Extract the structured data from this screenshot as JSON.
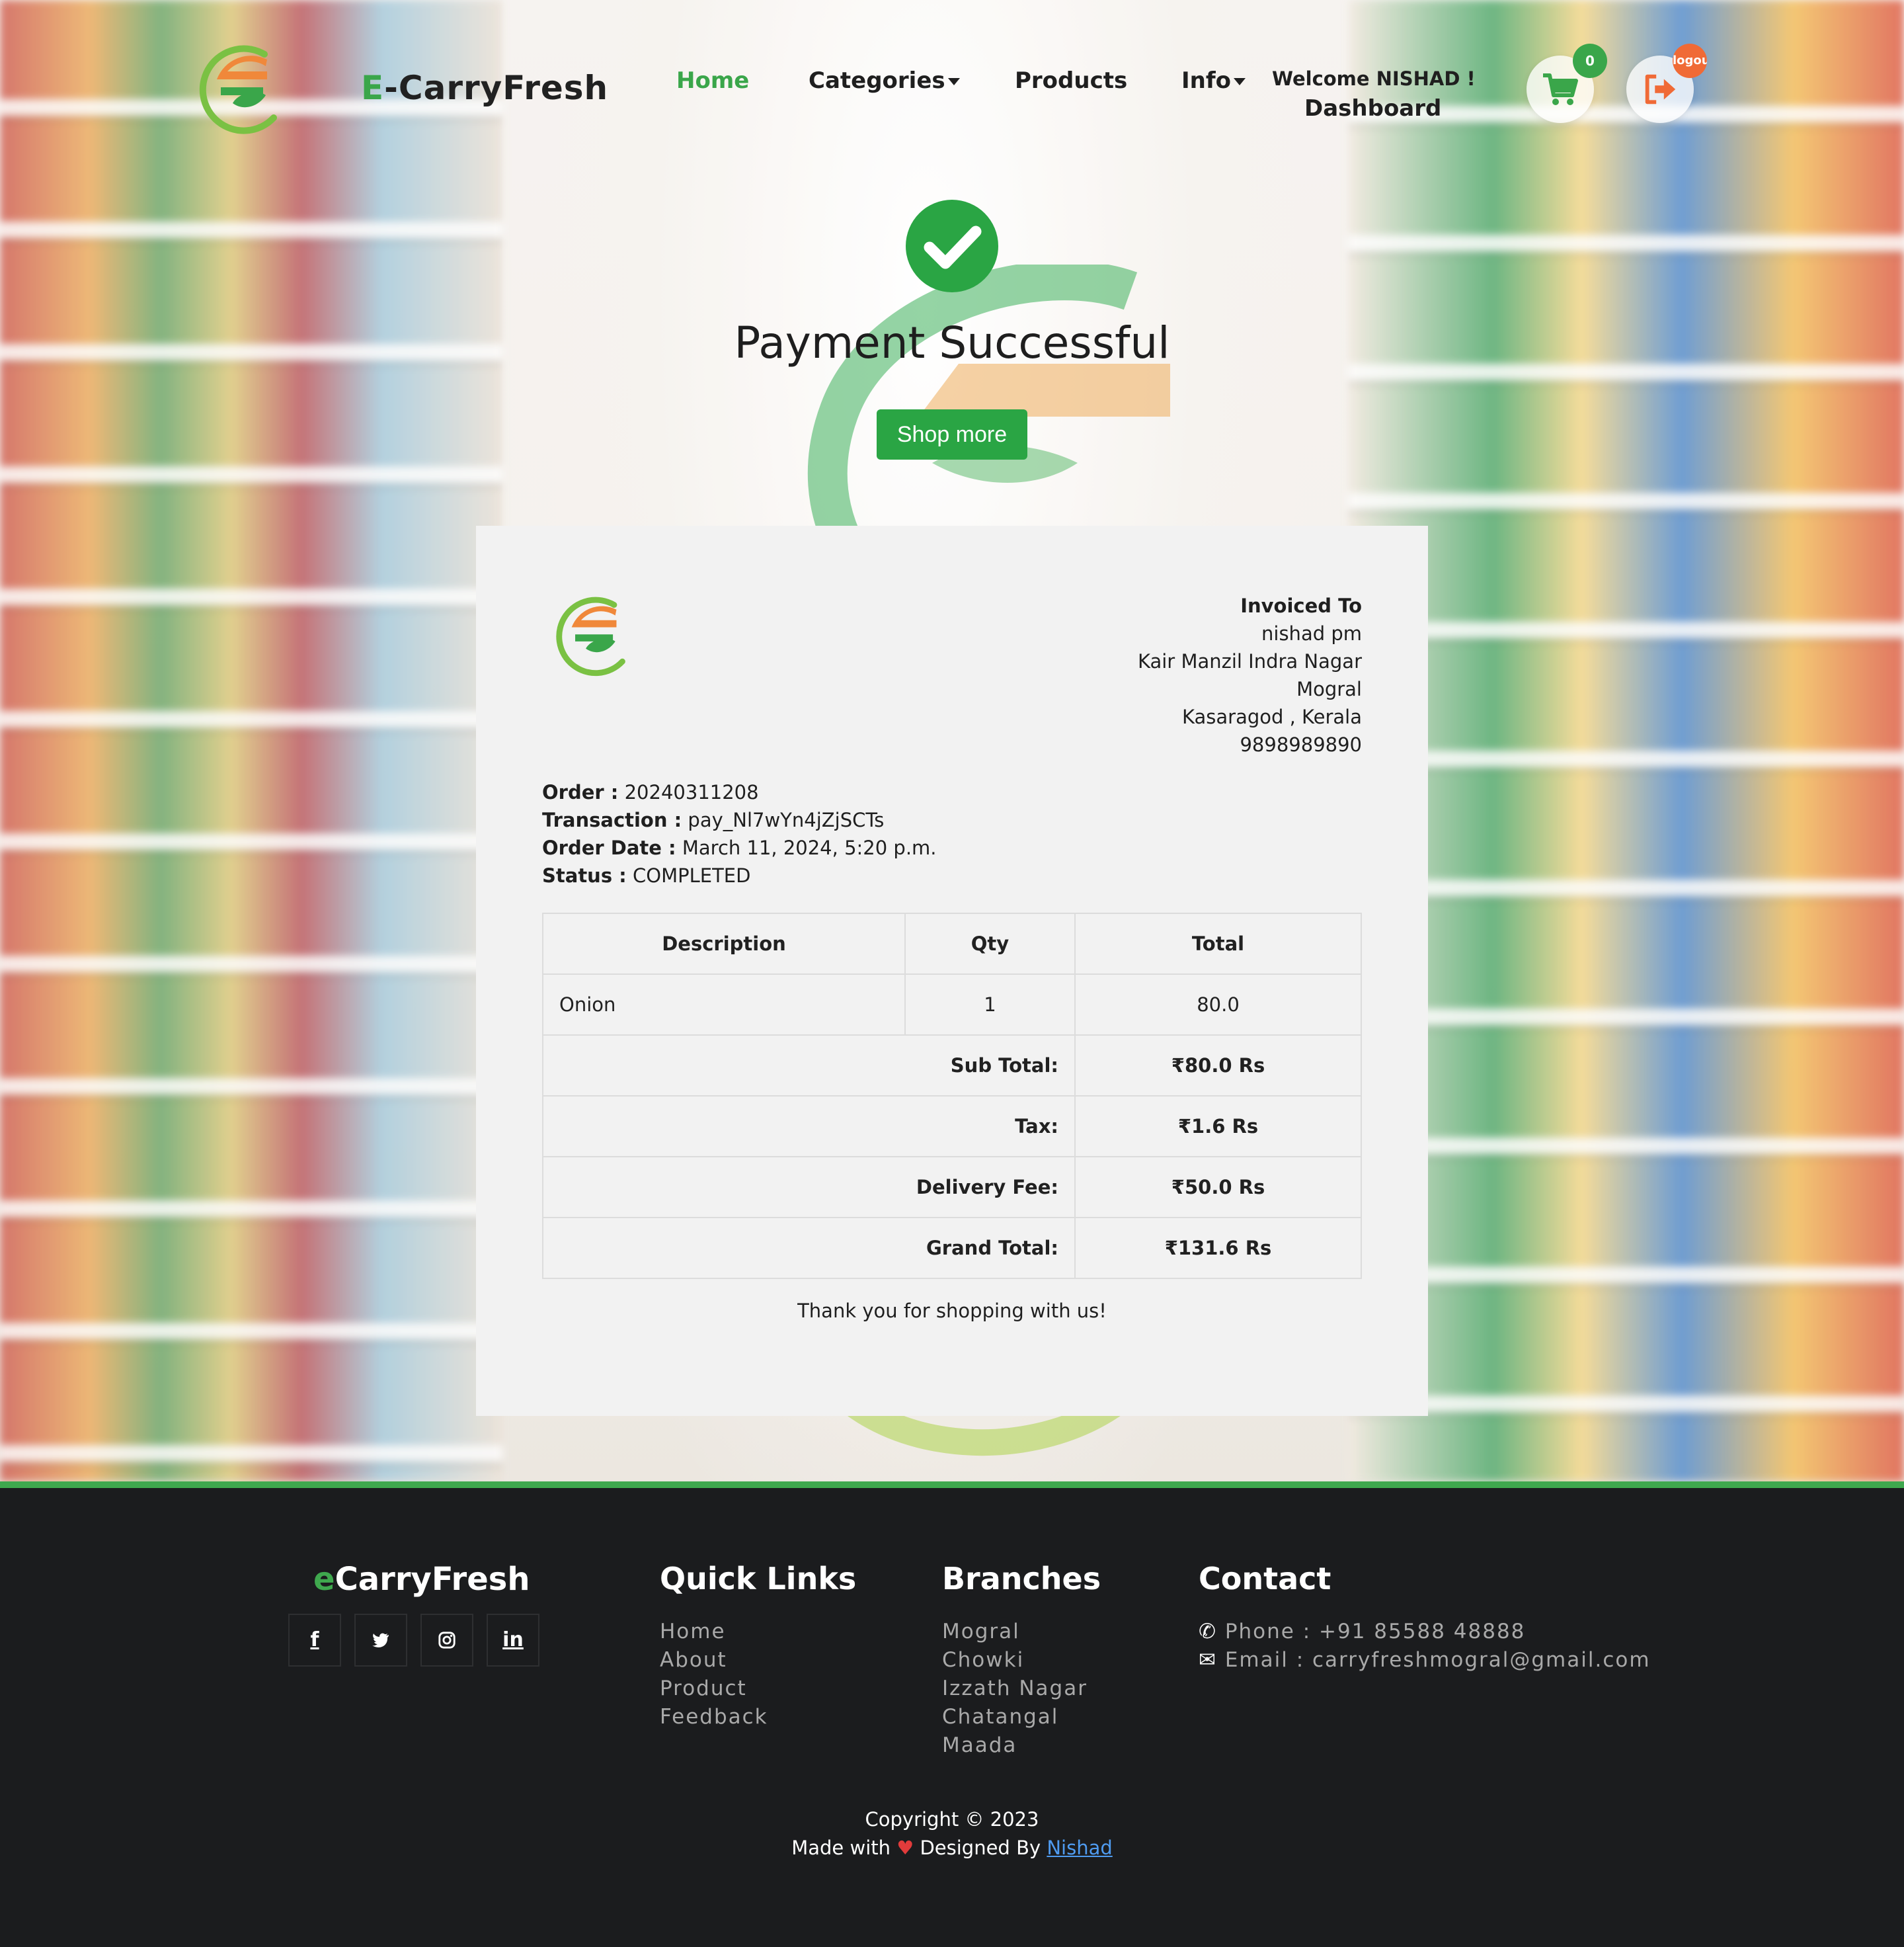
{
  "header": {
    "brand_first": "E",
    "brand_rest": "-CarryFresh",
    "nav": {
      "home": "Home",
      "categories": "Categories",
      "products": "Products",
      "info": "Info"
    },
    "welcome": "Welcome NISHAD !",
    "dashboard": "Dashboard",
    "cart_count": "0",
    "logout_label": "logout",
    "colors": {
      "accent": "#3aa64a",
      "logout": "#f06a36"
    }
  },
  "hero": {
    "title": "Payment Successful",
    "shop_more": "Shop more",
    "icon": "check-circle-icon"
  },
  "invoice": {
    "invoiced_to_label": "Invoiced To",
    "customer_name": "nishad pm",
    "address_line1": "Kair Manzil Indra Nagar",
    "address_line2": "Mogral",
    "address_line3": "Kasaragod , Kerala",
    "phone": "9898989890",
    "order_label": "Order :",
    "order_value": "20240311208",
    "transaction_label": "Transaction :",
    "transaction_value": "pay_Nl7wYn4jZjSCTs",
    "order_date_label": "Order Date :",
    "order_date_value": "March 11, 2024, 5:20 p.m.",
    "status_label": "Status :",
    "status_value": "COMPLETED",
    "columns": [
      "Description",
      "Qty",
      "Total"
    ],
    "items": [
      {
        "description": "Onion",
        "qty": "1",
        "total": "80.0"
      }
    ],
    "summary": [
      {
        "label": "Sub Total:",
        "value": "₹80.0 Rs"
      },
      {
        "label": "Tax:",
        "value": "₹1.6 Rs"
      },
      {
        "label": "Delivery Fee:",
        "value": "₹50.0 Rs"
      },
      {
        "label": "Grand Total:",
        "value": "₹131.6 Rs"
      }
    ],
    "thanks": "Thank you for shopping with us!"
  },
  "footer": {
    "brand_first": "e",
    "brand_rest": "CarryFresh",
    "social": [
      "facebook-icon",
      "twitter-icon",
      "instagram-icon",
      "linkedin-icon"
    ],
    "quick_links_title": "Quick Links",
    "quick_links": [
      "Home",
      "About",
      "Product",
      "Feedback"
    ],
    "branches_title": "Branches",
    "branches": [
      "Mogral",
      "Chowki",
      "Izzath Nagar",
      "Chatangal",
      "Maada"
    ],
    "contact_title": "Contact",
    "phone": "Phone : +91 85588 48888",
    "email": "Email : carryfreshmogral@gmail.com",
    "copyright": "Copyright © 2023",
    "made_with": "Made with",
    "designed_by": "Designed By",
    "author": "Nishad"
  }
}
